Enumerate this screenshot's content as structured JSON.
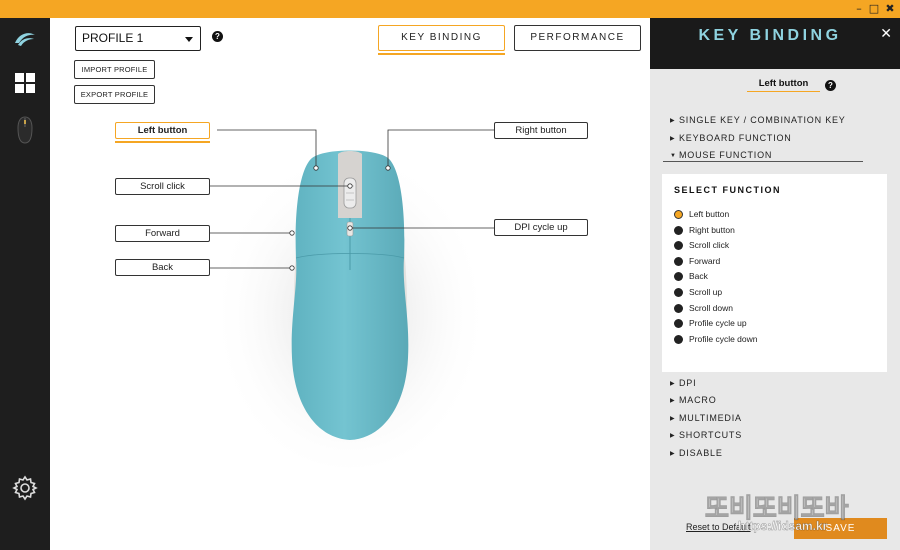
{
  "window": {
    "minimize_glyph": "–",
    "maximize_glyph": "□",
    "close_glyph": "✖"
  },
  "colors": {
    "accent": "#f5a623",
    "sidebar": "#1e1e1e",
    "panel_title": "#8fd3e0",
    "mouse_body": "#6fbfcc"
  },
  "sidebar": {
    "icons": [
      "brand-logo-icon",
      "dashboard-grid-icon",
      "mouse-device-icon",
      "settings-gear-icon"
    ]
  },
  "toolbar": {
    "profile_value": "PROFILE 1",
    "help_glyph": "?",
    "import_label": "IMPORT PROFILE",
    "export_label": "EXPORT PROFILE"
  },
  "tabs": [
    {
      "label": "KEY BINDING",
      "active": true
    },
    {
      "label": "PERFORMANCE",
      "active": false
    }
  ],
  "mouse_callouts": {
    "left_button": "Left button",
    "scroll_click": "Scroll click",
    "forward": "Forward",
    "back": "Back",
    "right_button": "Right button",
    "dpi_cycle_up": "DPI cycle up"
  },
  "panel": {
    "title": "KEY BINDING",
    "close_glyph": "✕",
    "selected_button": "Left button",
    "help_glyph": "?",
    "categories_top": [
      {
        "label": "SINGLE KEY / COMBINATION KEY",
        "glyph": "▶"
      },
      {
        "label": "KEYBOARD FUNCTION",
        "glyph": "▶"
      },
      {
        "label": "MOUSE FUNCTION",
        "glyph": "▼"
      }
    ],
    "select_function_title": "SELECT FUNCTION",
    "functions": [
      {
        "label": "Left button",
        "selected": true
      },
      {
        "label": "Right button",
        "selected": false
      },
      {
        "label": "Scroll click",
        "selected": false
      },
      {
        "label": "Forward",
        "selected": false
      },
      {
        "label": "Back",
        "selected": false
      },
      {
        "label": "Scroll up",
        "selected": false
      },
      {
        "label": "Scroll down",
        "selected": false
      },
      {
        "label": "Profile cycle up",
        "selected": false
      },
      {
        "label": "Profile cycle down",
        "selected": false
      }
    ],
    "categories_bottom": [
      {
        "label": "DPI",
        "glyph": "▶"
      },
      {
        "label": "MACRO",
        "glyph": "▶"
      },
      {
        "label": "MULTIMEDIA",
        "glyph": "▶"
      },
      {
        "label": "SHORTCUTS",
        "glyph": "▶"
      },
      {
        "label": "DISABLE",
        "glyph": "▶"
      }
    ],
    "reset_label": "Reset to Default",
    "save_label": "SAVE"
  },
  "watermark": {
    "text": "또비또비또바",
    "url": "https://idsam.kr"
  }
}
